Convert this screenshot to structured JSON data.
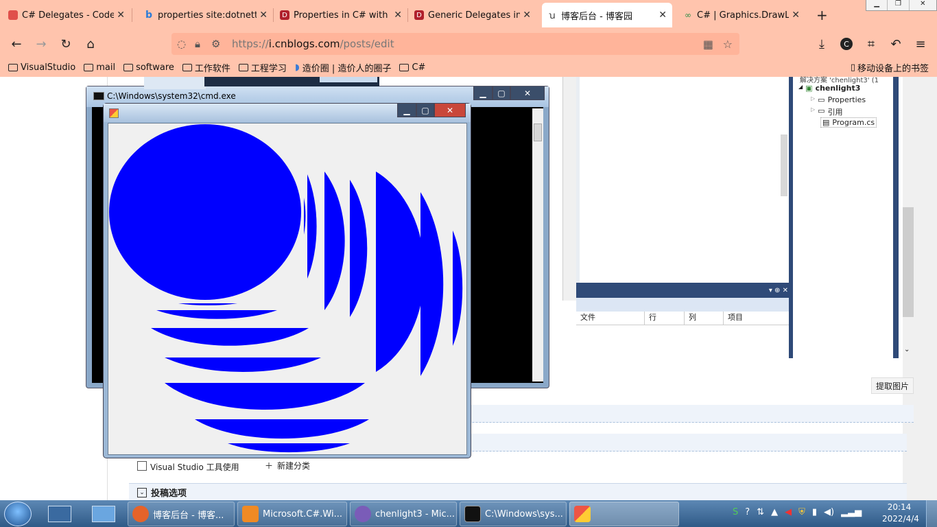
{
  "browser": {
    "tabs": [
      {
        "title": "C# Delegates - Code Ma",
        "favicon": "colorful-icon",
        "color": "#e0504b",
        "active": false
      },
      {
        "title": "properties site:dotnettut",
        "favicon": "bing-icon",
        "color": "#2b7bd6",
        "active": false
      },
      {
        "title": "Properties in C# with Re",
        "favicon": "dotnet-icon",
        "color": "#b0202c",
        "active": false
      },
      {
        "title": "Generic Delegates in C#",
        "favicon": "dotnet-icon",
        "color": "#b0202c",
        "active": false
      },
      {
        "title": "博客后台 - 博客园",
        "favicon": "cnblogs-icon",
        "color": "#444",
        "active": true
      },
      {
        "title": "C# | Graphics.DrawLine()",
        "favicon": "gfg-icon",
        "color": "#2f8d46",
        "active": false
      }
    ],
    "url_prefix": "https://",
    "url_host": "i.cnblogs.com",
    "url_path": "/posts/edit",
    "bookmarks": [
      "VisualStudio",
      "mail",
      "software",
      "工作软件",
      "工程学习",
      "造价圈 | 造价人的圈子",
      "C#"
    ],
    "mobile_bookmarks": "移动设备上的书签"
  },
  "page": {
    "checkbox_label": "Visual Studio 工具使用",
    "new_category": "新建分类",
    "post_options": "投稿选项",
    "extract_image_button": "提取图片"
  },
  "vs": {
    "solution_row": "解决方案 'chenlight3' (1",
    "project": "chenlight3",
    "nodes": [
      "Properties",
      "引用",
      "Program.cs"
    ],
    "error_columns": [
      "文件",
      "行",
      "列",
      "项目"
    ]
  },
  "cmd": {
    "title": "C:\\Windows\\system32\\cmd.exe"
  },
  "taskbar": {
    "items": [
      {
        "label": "博客后台 - 博客...",
        "color": "#e5632a"
      },
      {
        "label": "Microsoft.C#.Wi...",
        "color": "#f08a24"
      },
      {
        "label": "chenlight3 - Mic...",
        "color": "#7a5cb8"
      },
      {
        "label": "C:\\Windows\\sys...",
        "color": "#111"
      }
    ],
    "time": "20:14",
    "date": "2022/4/4"
  }
}
